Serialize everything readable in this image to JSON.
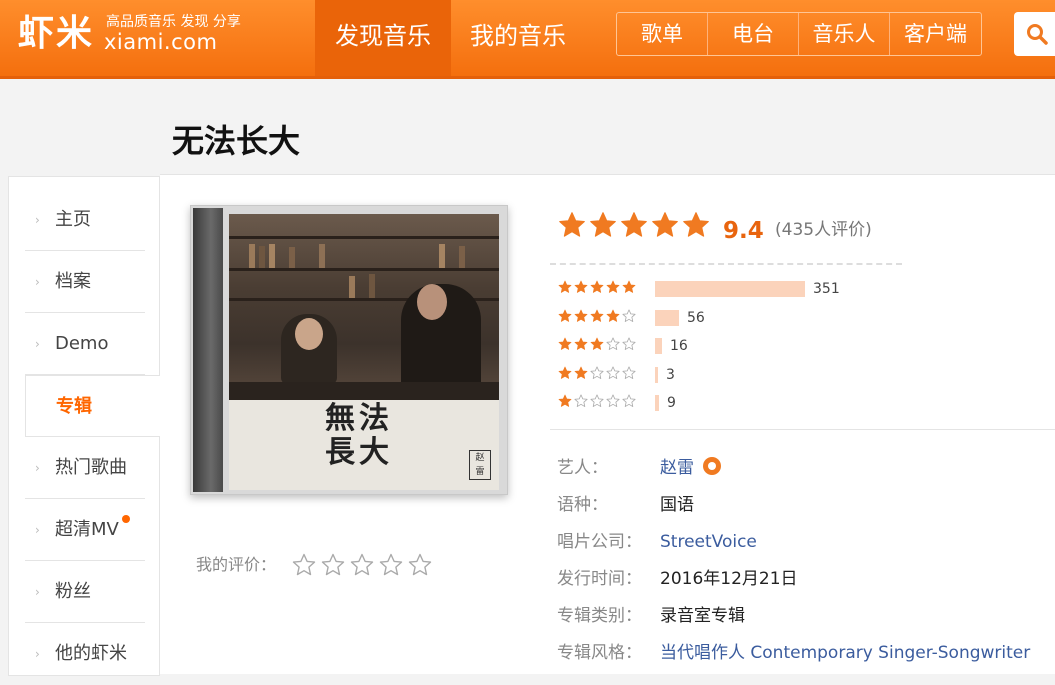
{
  "header": {
    "logo_cn": "虾米",
    "logo_slogan": "高品质音乐 发现 分享",
    "logo_domain": "xiami.com",
    "nav": [
      {
        "label": "发现音乐",
        "active": true
      },
      {
        "label": "我的音乐",
        "active": false
      }
    ],
    "sub_nav": [
      "歌单",
      "电台",
      "音乐人",
      "客户端"
    ]
  },
  "page": {
    "title": "无法长大"
  },
  "sidebar": {
    "items": [
      {
        "label": "主页",
        "active": false,
        "dot": false
      },
      {
        "label": "档案",
        "active": false,
        "dot": false
      },
      {
        "label": "Demo",
        "active": false,
        "dot": false
      },
      {
        "label": "专辑",
        "active": true,
        "dot": false
      },
      {
        "label": "热门歌曲",
        "active": false,
        "dot": false
      },
      {
        "label": "超清MV",
        "active": false,
        "dot": true
      },
      {
        "label": "粉丝",
        "active": false,
        "dot": false
      },
      {
        "label": "他的虾米",
        "active": false,
        "dot": false
      }
    ]
  },
  "cover": {
    "title_line1": "無法",
    "title_line2": "長大",
    "seal_text": "赵雷"
  },
  "my_rating": {
    "label": "我的评价：",
    "stars": 0,
    "max": 5
  },
  "rating": {
    "score": "9.4",
    "count_text": "(435人评价)",
    "stars": 5,
    "distribution": [
      {
        "stars": 5,
        "count": 351
      },
      {
        "stars": 4,
        "count": 56
      },
      {
        "stars": 3,
        "count": 16
      },
      {
        "stars": 2,
        "count": 3
      },
      {
        "stars": 1,
        "count": 9
      }
    ]
  },
  "info": [
    {
      "label": "艺人：",
      "value": "赵雷",
      "link": true
    },
    {
      "label": "语种：",
      "value": "国语",
      "link": false
    },
    {
      "label": "唱片公司：",
      "value": "StreetVoice",
      "link": true
    },
    {
      "label": "发行时间：",
      "value": "2016年12月21日",
      "link": false
    },
    {
      "label": "专辑类别：",
      "value": "录音室专辑",
      "link": false
    },
    {
      "label": "专辑风格：",
      "value": "当代唱作人 Contemporary Singer-Songwriter",
      "link": true
    }
  ],
  "colors": {
    "brand_orange": "#f47a1e",
    "star_orange": "#f07a21",
    "link_blue": "#3b5c9e",
    "bar_fill": "#fbd3bb"
  }
}
